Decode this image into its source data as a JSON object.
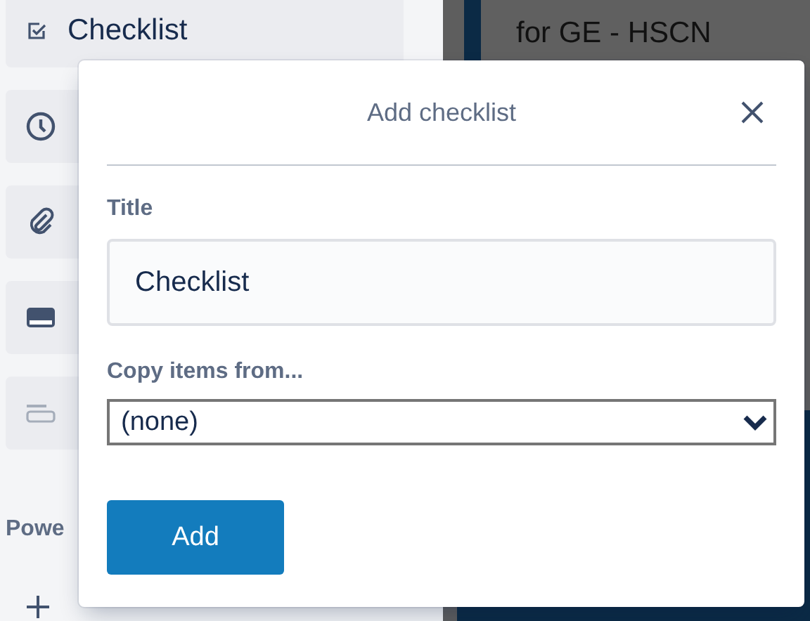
{
  "sidebar": {
    "items": [
      {
        "kind": "checklist",
        "label": "Checklist"
      },
      {
        "kind": "clock"
      },
      {
        "kind": "attachment"
      },
      {
        "kind": "cover"
      },
      {
        "kind": "fields"
      }
    ],
    "section_heading": "Powe"
  },
  "card": {
    "title": "for GE - HSCN"
  },
  "popover": {
    "title": "Add checklist",
    "title_label": "Title",
    "title_value": "Checklist",
    "copy_label": "Copy items from...",
    "copy_value": "(none)",
    "button": "Add"
  }
}
